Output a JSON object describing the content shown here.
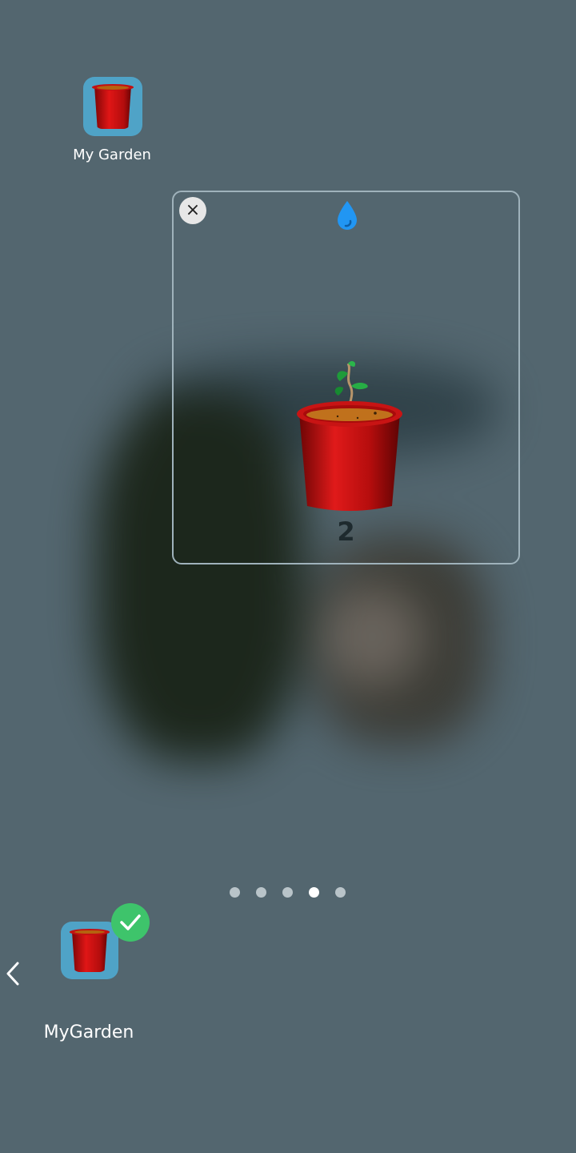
{
  "home": {
    "app_label": "My Garden",
    "app_icon": "flower-pot-icon"
  },
  "widget": {
    "close_icon_glyph": "×",
    "drop_icon": "water-drop-icon",
    "drop_color": "#2196f3",
    "plant_icon": "seedling-pot-icon",
    "count": "2"
  },
  "pager": {
    "total": 5,
    "active_index": 3
  },
  "dock": {
    "app_label": "MyGarden",
    "app_icon": "flower-pot-icon",
    "badge_icon": "check-icon",
    "badge_color": "#3ec46b",
    "back_icon": "chevron-left-icon"
  },
  "colors": {
    "background": "#53666f",
    "icon_bg": "#4fa3c7",
    "pot_red": "#d01010"
  }
}
